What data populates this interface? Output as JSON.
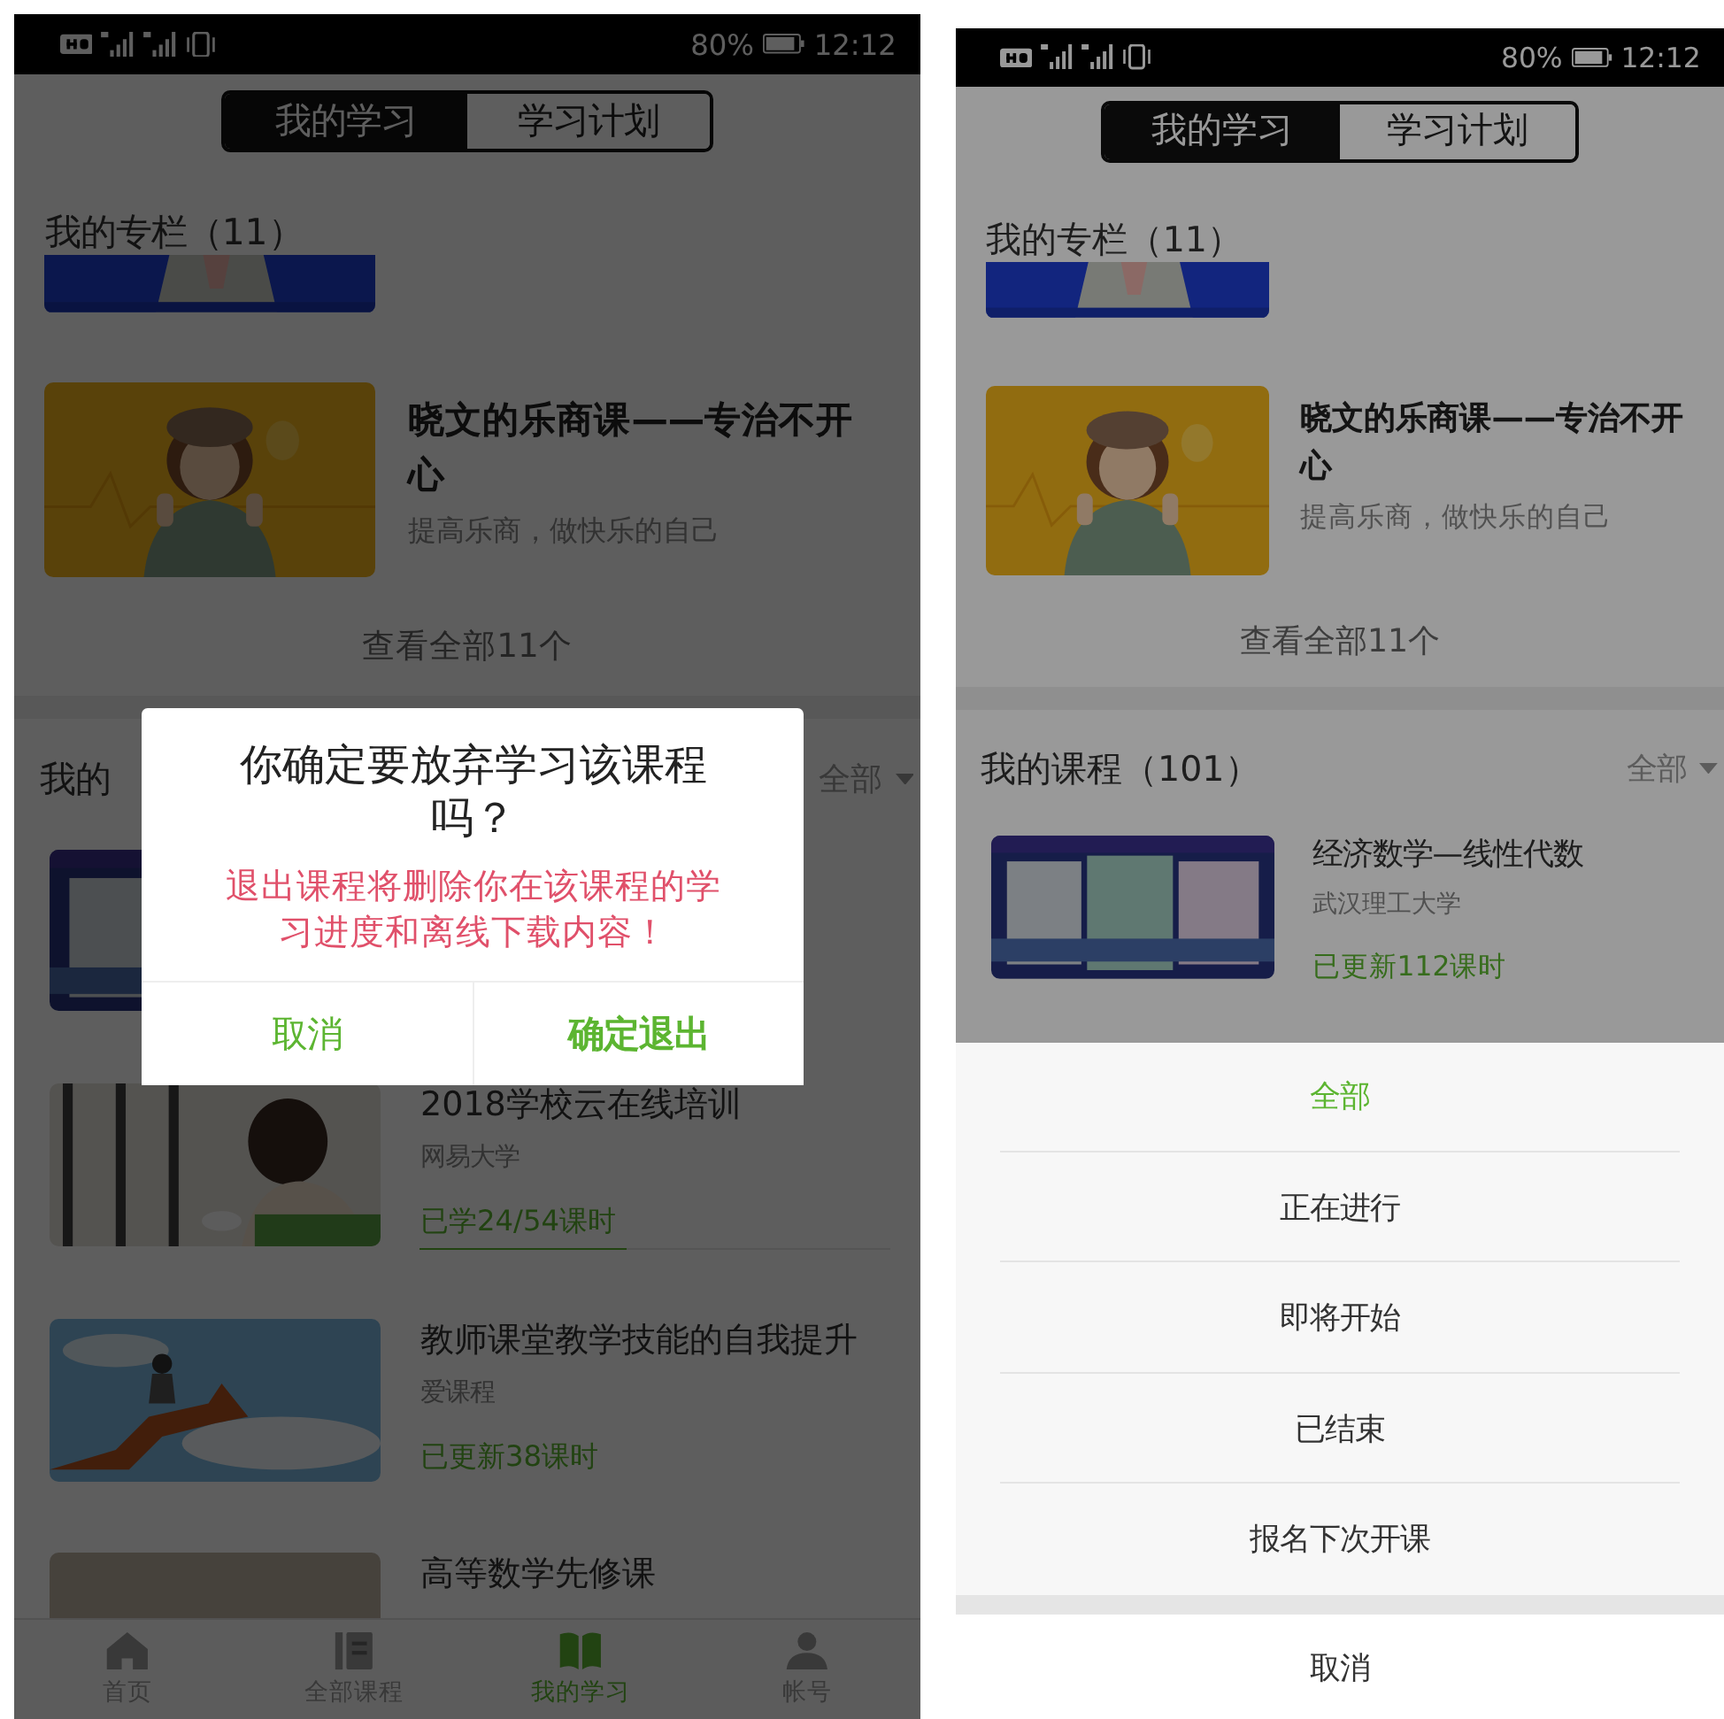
{
  "screens": [
    {
      "status_bar": {
        "battery": "80%",
        "time": "12:12"
      },
      "tabs": [
        {
          "label": "我的学习",
          "selected": true
        },
        {
          "label": "学习计划",
          "selected": false
        }
      ],
      "columns": {
        "heading": "我的专栏（11）",
        "items": [
          {
            "title": "晓文的乐商课——专治不开心",
            "subtitle": "提高乐商，做快乐的自己"
          }
        ],
        "see_all": "查看全部11个"
      },
      "courses": {
        "heading": "我的",
        "filter": "全部",
        "items": [
          {
            "thumb": {
              "kind": "picture"
            }
          },
          {
            "thumb": {
              "kind": "picture"
            },
            "title": "2018学校云在线培训",
            "org": "网易大学",
            "status": "已学24/54课时",
            "level": 0.44
          },
          {
            "thumb": {
              "kind": "picture"
            },
            "title": "教师课堂教学技能的自我提升",
            "org": "爱课程",
            "status": "已更新38课时"
          },
          {
            "thumb": {
              "kind": "picture"
            },
            "title": "高等数学先修课"
          }
        ]
      },
      "bottom_nav": [
        {
          "kind": "home",
          "label": "首页",
          "selected": false
        },
        {
          "kind": "catalog",
          "label": "全部课程",
          "selected": false
        },
        {
          "kind": "book",
          "label": "我的学习",
          "selected": true
        },
        {
          "kind": "person",
          "label": "帐号",
          "selected": false
        }
      ],
      "dialog": {
        "title": "你确定要放弃学习该课程吗？",
        "message": "退出课程将删除你在该课程的学习进度和离线下载内容！",
        "buttons": [
          {
            "kind": "cancel",
            "label": "取消"
          },
          {
            "kind": "confirm",
            "label": "确定退出"
          }
        ]
      }
    },
    {
      "status_bar": {
        "battery": "80%",
        "time": "12:12"
      },
      "tabs": [
        {
          "label": "我的学习",
          "selected": true
        },
        {
          "label": "学习计划",
          "selected": false
        }
      ],
      "columns": {
        "heading": "我的专栏（11）",
        "items": [
          {
            "title": "晓文的乐商课——专治不开心",
            "subtitle": "提高乐商，做快乐的自己"
          }
        ],
        "see_all": "查看全部11个"
      },
      "courses": {
        "heading": "我的课程（101）",
        "filter": "全部",
        "items": [
          {
            "thumb": {
              "kind": "picture"
            },
            "title": "经济数学—线性代数",
            "org": "武汉理工大学",
            "status": "已更新112课时"
          }
        ]
      },
      "action_sheet": {
        "options": [
          {
            "label": "全部",
            "selected": true
          },
          {
            "label": "正在进行",
            "selected": false
          },
          {
            "label": "即将开始",
            "selected": false
          },
          {
            "label": "已结束",
            "selected": false
          },
          {
            "label": "报名下次开课",
            "selected": false
          }
        ],
        "cancel": "取消"
      }
    }
  ]
}
